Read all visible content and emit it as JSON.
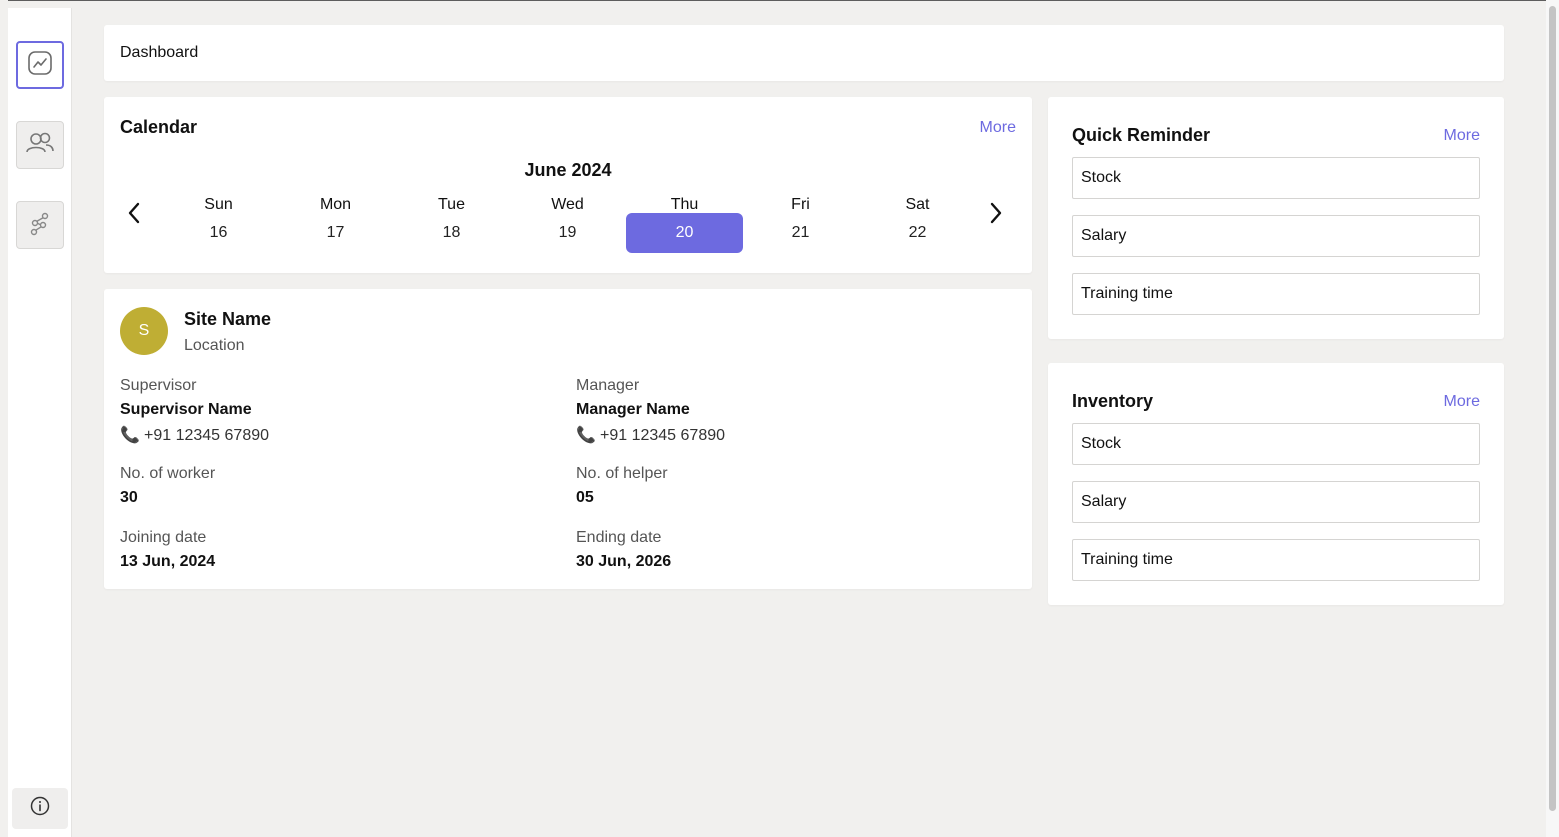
{
  "header": {
    "title": "Dashboard"
  },
  "sidebar": {
    "items": [
      {
        "icon": "chart-line-icon",
        "active": true
      },
      {
        "icon": "users-icon",
        "active": false
      },
      {
        "icon": "network-icon",
        "active": false
      }
    ],
    "footer_icon": "info-icon"
  },
  "calendar": {
    "title": "Calendar",
    "more_label": "More",
    "month": "June 2024",
    "days": [
      {
        "name": "Sun",
        "num": "16"
      },
      {
        "name": "Mon",
        "num": "17"
      },
      {
        "name": "Tue",
        "num": "18"
      },
      {
        "name": "Wed",
        "num": "19"
      },
      {
        "name": "Thu",
        "num": "20"
      },
      {
        "name": "Fri",
        "num": "21"
      },
      {
        "name": "Sat",
        "num": "22"
      }
    ],
    "selected_day": "20"
  },
  "site": {
    "avatar_letter": "S",
    "name": "Site Name",
    "location": "Location",
    "supervisor": {
      "label": "Supervisor",
      "name": "Supervisor Name",
      "phone": "+91 12345 67890"
    },
    "manager": {
      "label": "Manager",
      "name": "Manager Name",
      "phone": "+91 12345 67890"
    },
    "workers": {
      "label": "No. of worker",
      "value": "30"
    },
    "helpers": {
      "label": "No. of helper",
      "value": "05"
    },
    "joining": {
      "label": "Joining date",
      "value": "13 Jun, 2024"
    },
    "ending": {
      "label": "Ending date",
      "value": "30 Jun, 2026"
    }
  },
  "quick_reminder": {
    "title": "Quick Reminder",
    "more_label": "More",
    "items": [
      "Stock",
      "Salary",
      "Training time"
    ]
  },
  "inventory": {
    "title": "Inventory",
    "more_label": "More",
    "items": [
      "Stock",
      "Salary",
      "Training time"
    ]
  },
  "colors": {
    "accent": "#6d6ae0",
    "avatar": "#bfae34",
    "background": "#f1f0ee"
  }
}
